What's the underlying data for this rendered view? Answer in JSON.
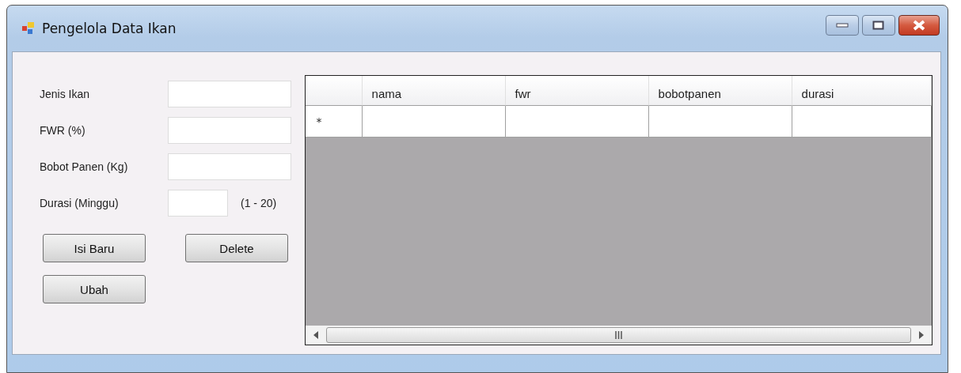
{
  "window": {
    "title": "Pengelola Data Ikan"
  },
  "form": {
    "fields": [
      {
        "label": "Jenis Ikan"
      },
      {
        "label": "FWR (%)"
      },
      {
        "label": "Bobot Panen (Kg)"
      },
      {
        "label": "Durasi (Minggu)",
        "hint": "(1 - 20)"
      }
    ]
  },
  "buttons": [
    {
      "label": "Isi Baru"
    },
    {
      "label": "Delete"
    },
    {
      "label": "Ubah"
    }
  ],
  "table": {
    "columns": [
      "nama",
      "fwr",
      "bobotpanen",
      "durasi"
    ],
    "new_row_marker": "*"
  }
}
